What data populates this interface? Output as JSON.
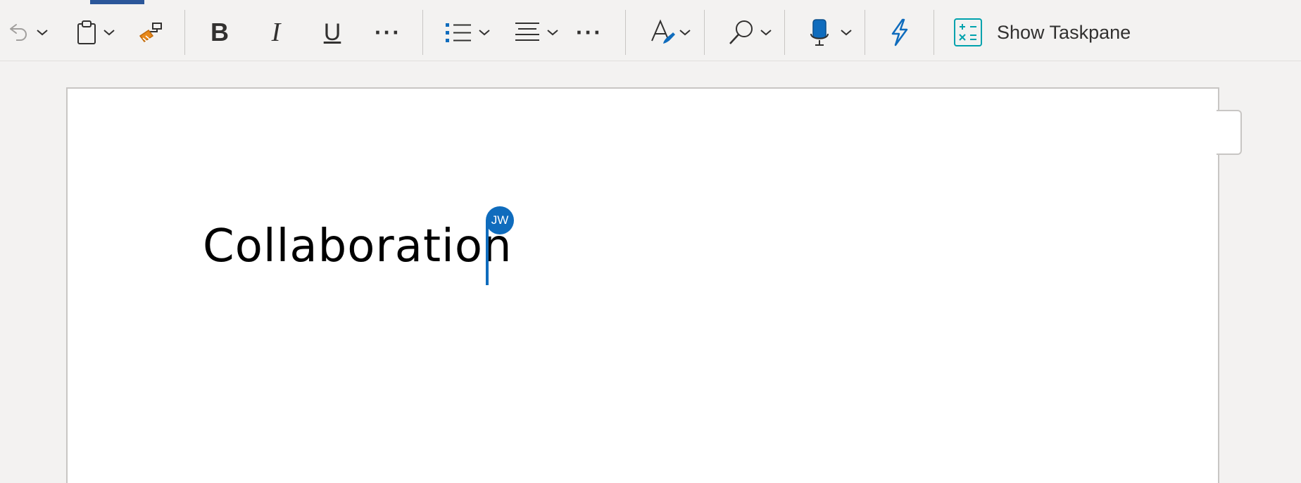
{
  "toolbar": {
    "undo_icon": "undo-icon",
    "paste_icon": "clipboard-icon",
    "format_painter_icon": "paintbrush-icon",
    "bold_label": "B",
    "italic_label": "I",
    "underline_label": "U",
    "more_font_label": "···",
    "bullets_icon": "bulleted-list-icon",
    "align_icon": "align-icon",
    "more_paragraph_label": "···",
    "styles_icon": "styles-icon",
    "find_icon": "search-icon",
    "dictate_icon": "microphone-icon",
    "designer_icon": "lightning-icon",
    "taskpane_icon": "calculator-icon",
    "show_taskpane_label": "Show Taskpane"
  },
  "document": {
    "text": "Collaboration",
    "collaborator_initials": "JW"
  },
  "colors": {
    "accent": "#2b579a",
    "cursor": "#0f6cbd",
    "lightning": "#0f6cbd",
    "taskpane_icon": "#00a2ad",
    "paintbrush": "#e8891b"
  }
}
